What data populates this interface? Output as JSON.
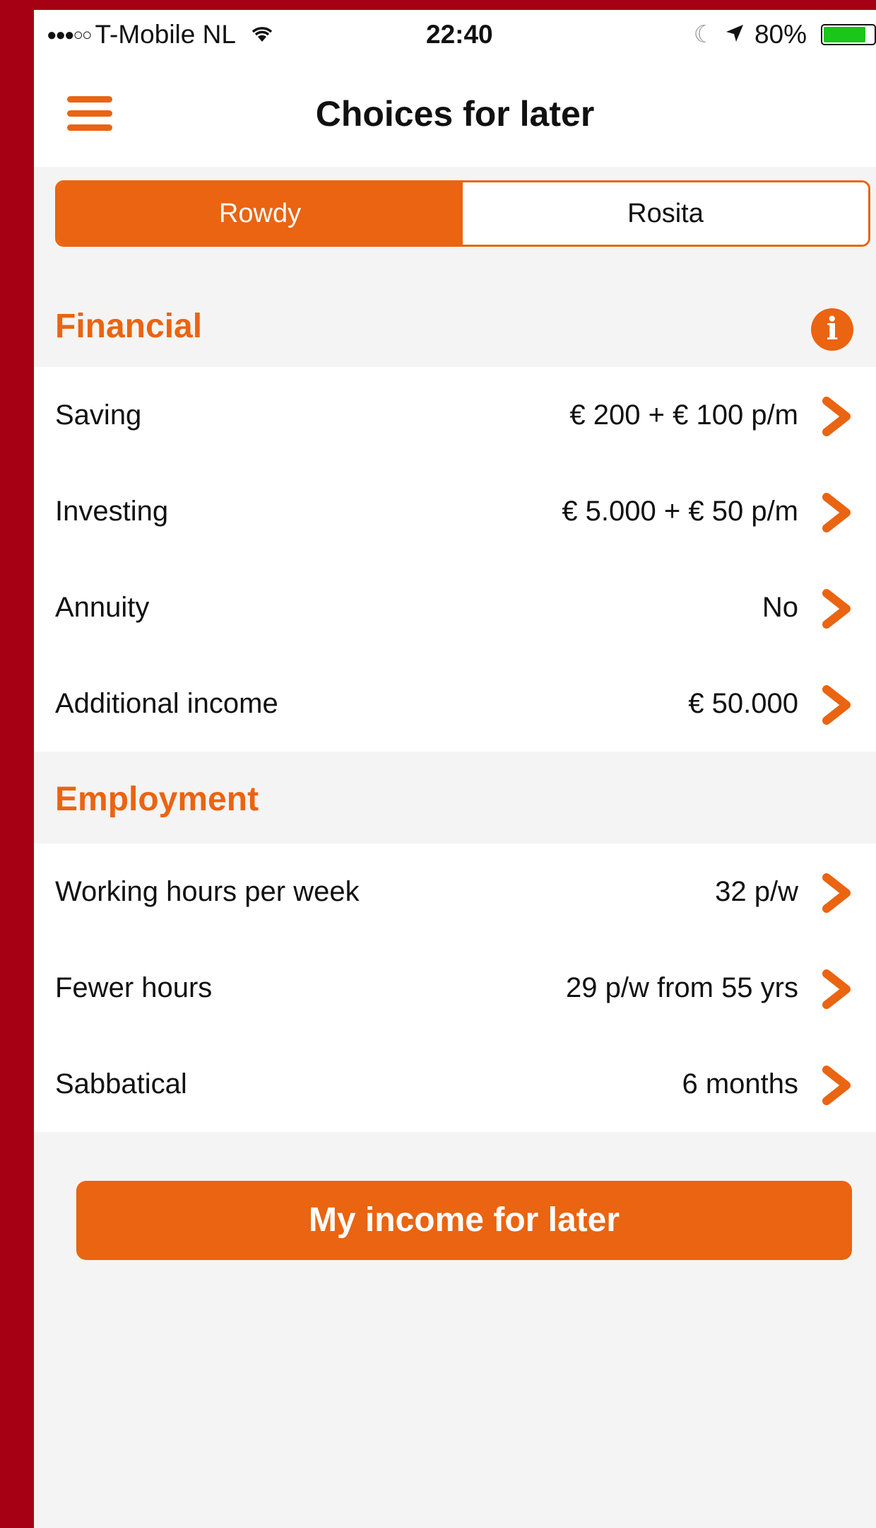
{
  "status_bar": {
    "carrier": "T-Mobile NL",
    "time": "22:40",
    "battery": "80%"
  },
  "nav": {
    "title": "Choices for later"
  },
  "tabs": [
    {
      "label": "Rowdy",
      "active": true
    },
    {
      "label": "Rosita",
      "active": false
    }
  ],
  "financial": {
    "title": "Financial",
    "items": [
      {
        "label": "Saving",
        "value": "€ 200 + € 100 p/m"
      },
      {
        "label": "Investing",
        "value": "€ 5.000 + € 50 p/m"
      },
      {
        "label": "Annuity",
        "value": "No"
      },
      {
        "label": "Additional income",
        "value": "€ 50.000"
      }
    ]
  },
  "employment": {
    "title": "Employment",
    "items": [
      {
        "label": "Working hours per week",
        "value": "32 p/w"
      },
      {
        "label": "Fewer hours",
        "value": "29 p/w from 55 yrs"
      },
      {
        "label": "Sabbatical",
        "value": "6 months"
      }
    ]
  },
  "button": {
    "label": "My income for later"
  },
  "colors": {
    "accent": "#ea6411",
    "background": "#f4f4f4",
    "frame": "#a50013"
  }
}
